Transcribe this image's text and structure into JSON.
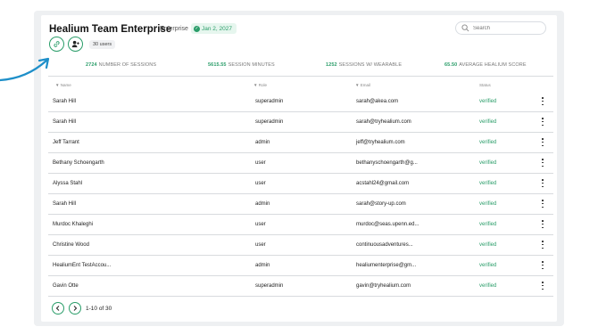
{
  "header": {
    "title": "Healium Team Enterprise",
    "plan": "Enterprise",
    "date": "Jan 2, 2027",
    "users_count": "30 users"
  },
  "search": {
    "placeholder": "Search"
  },
  "stats": [
    {
      "value": "2724",
      "label": "NUMBER OF SESSIONS"
    },
    {
      "value": "5615.55",
      "label": "SESSION MINUTES"
    },
    {
      "value": "1252",
      "label": "SESSIONS W/ WEARABLE"
    },
    {
      "value": "65.50",
      "label": "AVERAGE HEALIUM SCORE"
    }
  ],
  "table": {
    "columns": [
      "Name",
      "Role",
      "Email",
      "Status"
    ],
    "sort_arrow": "▼",
    "rows": [
      {
        "name": "Sarah Hill",
        "role": "superadmin",
        "email": "sarah@akea.com",
        "status": "verified"
      },
      {
        "name": "Sarah Hill",
        "role": "superadmin",
        "email": "sarah@tryhealium.com",
        "status": "verified"
      },
      {
        "name": "Jeff Tarrant",
        "role": "admin",
        "email": "jeff@tryhealium.com",
        "status": "verified"
      },
      {
        "name": "Bethany Schoengarth",
        "role": "user",
        "email": "bethanyschoengarth@g...",
        "status": "verified"
      },
      {
        "name": "Alyssa Stahl",
        "role": "user",
        "email": "acstahl24@gmail.com",
        "status": "verified"
      },
      {
        "name": "Sarah Hill",
        "role": "admin",
        "email": "sarah@story-up.com",
        "status": "verified"
      },
      {
        "name": "Murdoc Khaleghi",
        "role": "user",
        "email": "murdoc@seas.upenn.ed...",
        "status": "verified"
      },
      {
        "name": "Christine Wood",
        "role": "user",
        "email": "continuousadventures...",
        "status": "verified"
      },
      {
        "name": "HealiumEnt TestAccou...",
        "role": "admin",
        "email": "healiumenterprise@gm...",
        "status": "verified"
      },
      {
        "name": "Gavin Otte",
        "role": "superadmin",
        "email": "gavin@tryhealium.com",
        "status": "verified"
      }
    ]
  },
  "pagination": {
    "text": "1-10 of 30"
  },
  "icons": {
    "link": "link-icon",
    "user": "user-icon",
    "search": "search-icon",
    "check": "check-icon",
    "more": "more-vertical-icon",
    "prev": "chevron-left-icon",
    "next": "chevron-right-icon",
    "arrow": "curved-arrow-icon"
  },
  "colors": {
    "accent": "#2a9d69",
    "arrow": "#1e8fc9",
    "badge_bg": "#e6f6ee"
  }
}
